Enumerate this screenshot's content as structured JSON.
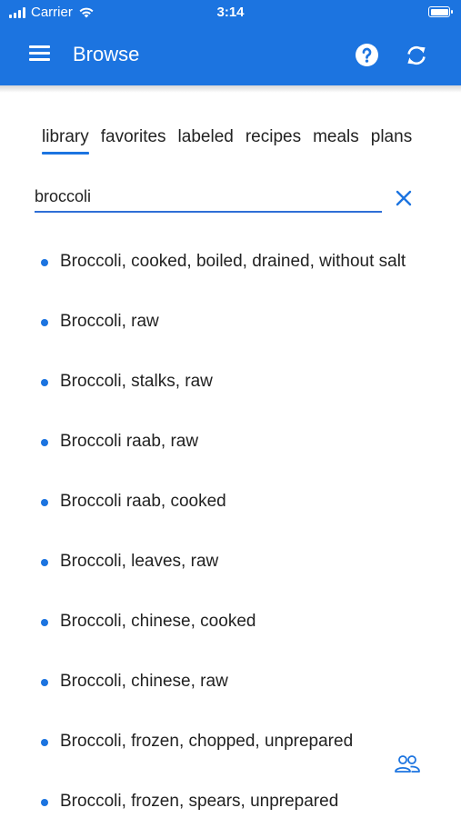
{
  "status_bar": {
    "carrier": "Carrier",
    "time": "3:14"
  },
  "header": {
    "title": "Browse"
  },
  "tabs": [
    {
      "label": "library",
      "active": true
    },
    {
      "label": "favorites",
      "active": false
    },
    {
      "label": "labeled",
      "active": false
    },
    {
      "label": "recipes",
      "active": false
    },
    {
      "label": "meals",
      "active": false
    },
    {
      "label": "plans",
      "active": false
    }
  ],
  "search": {
    "value": "broccoli"
  },
  "results": [
    "Broccoli, cooked, boiled, drained, without salt",
    "Broccoli, raw",
    "Broccoli, stalks, raw",
    "Broccoli raab, raw",
    "Broccoli raab, cooked",
    "Broccoli, leaves, raw",
    "Broccoli, chinese, cooked",
    "Broccoli, chinese, raw",
    "Broccoli, frozen, chopped, unprepared",
    "Broccoli, frozen, spears, unprepared"
  ],
  "icons": {
    "menu": "hamburger-menu-icon",
    "help": "help-circle-icon",
    "sync": "sync-icon",
    "clear": "close-icon",
    "people": "people-icon"
  },
  "colors": {
    "accent": "#1c74e0",
    "app_bar": "#1c74e0",
    "background": "#ffffff",
    "text": "#222222"
  }
}
